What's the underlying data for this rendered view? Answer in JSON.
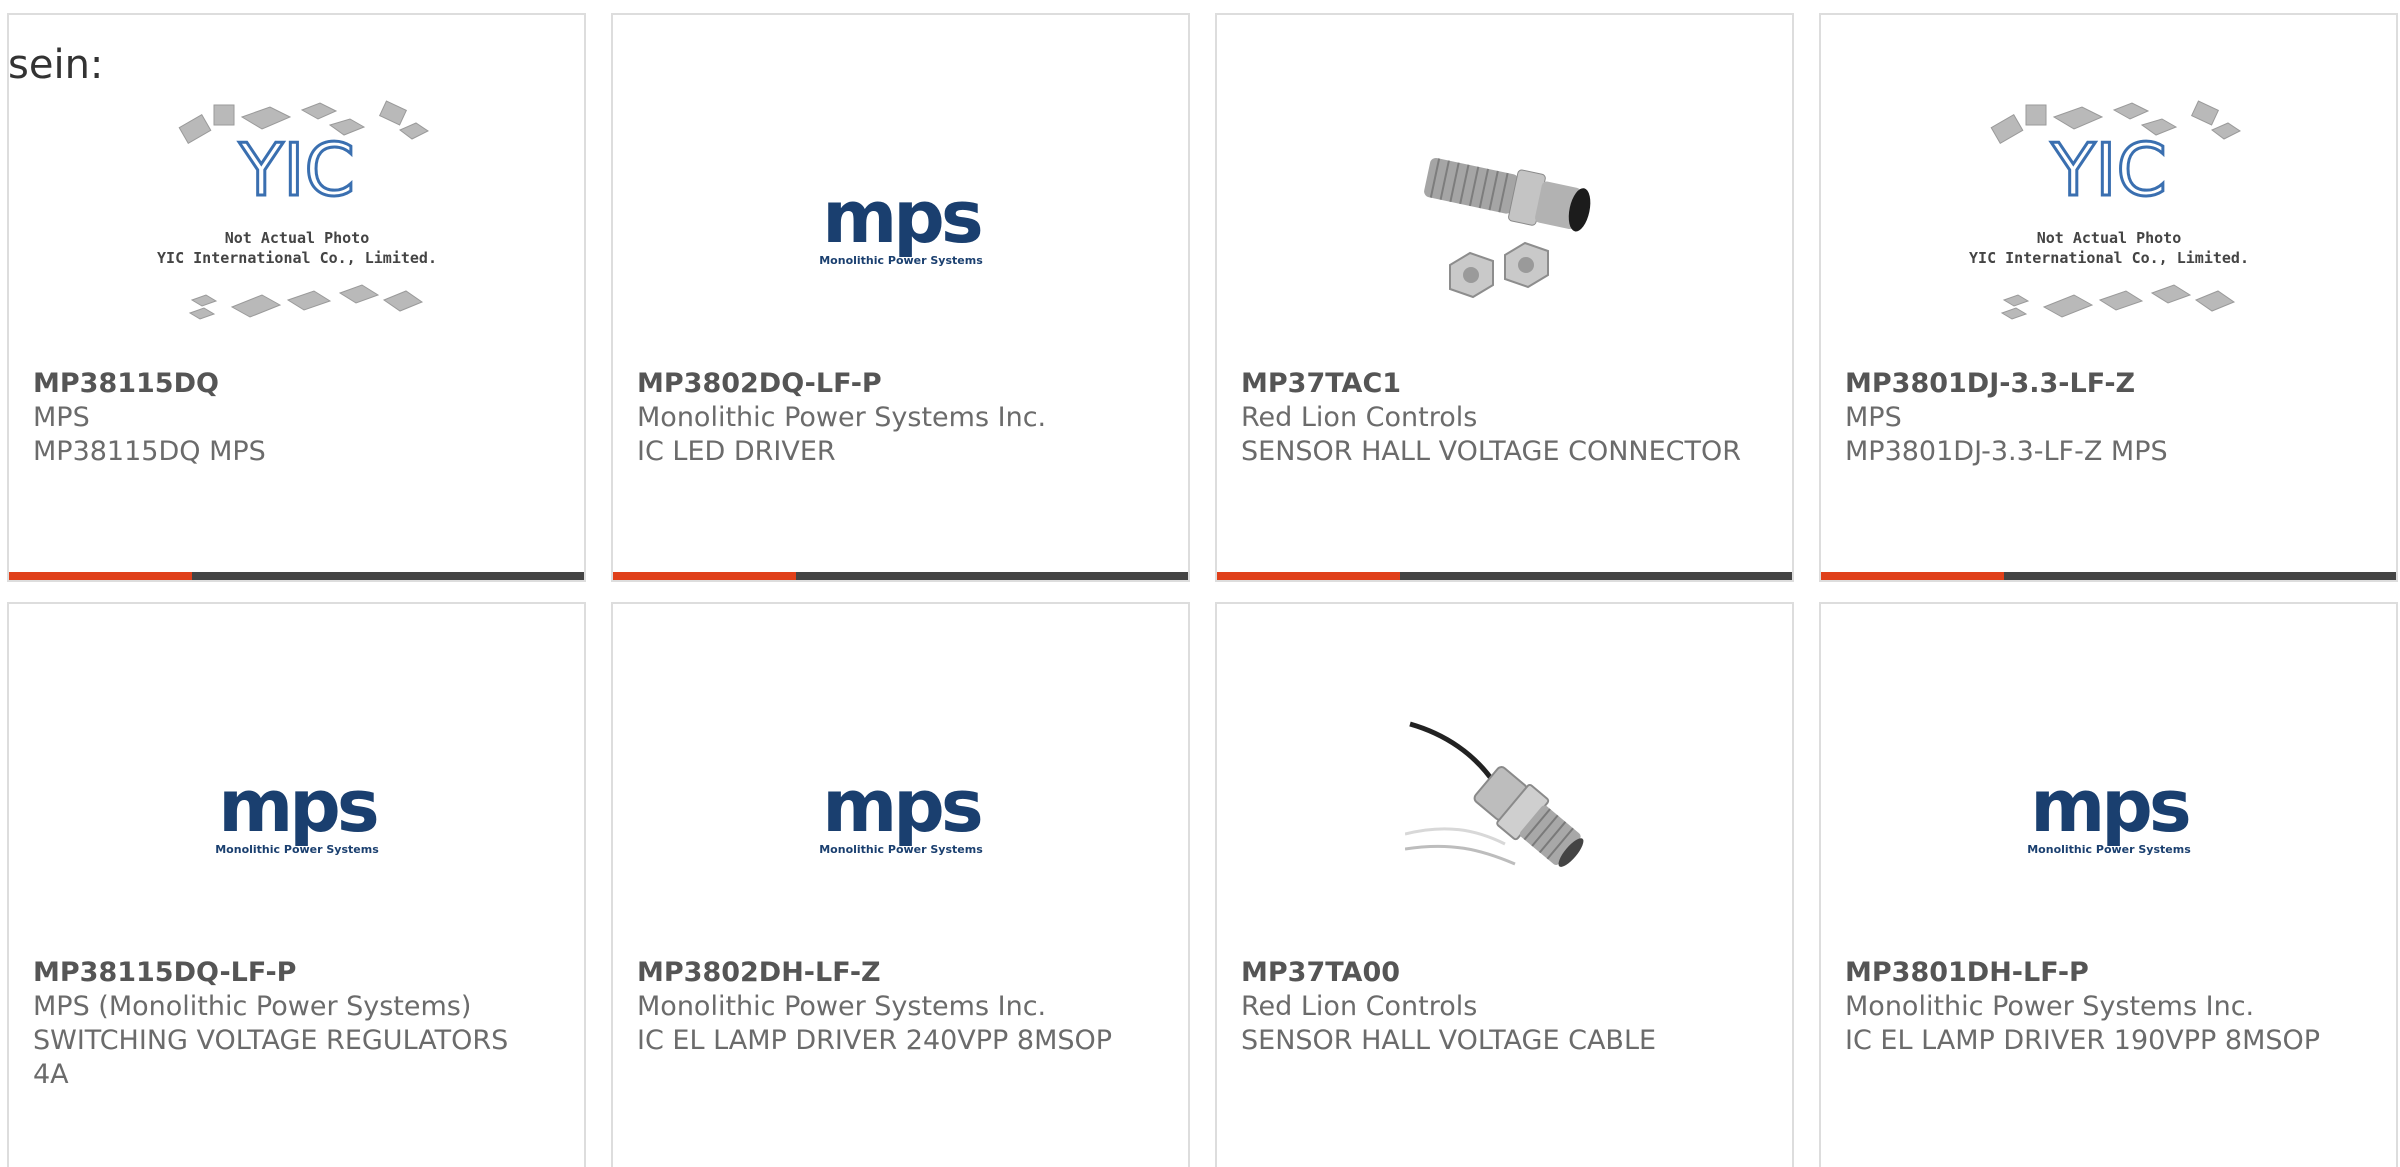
{
  "header": {
    "text": "sein:"
  },
  "colors": {
    "accent": "#e0401a",
    "bar": "#444444",
    "mps_blue": "#1a3f6f"
  },
  "products": [
    {
      "part": "MP38115DQ",
      "maker": "MPS",
      "desc": "MP38115DQ MPS",
      "image": "yic-placeholder",
      "image_text": [
        "Not Actual Photo",
        "YIC International Co., Limited."
      ]
    },
    {
      "part": "MP3802DQ-LF-P",
      "maker": "Monolithic Power Systems Inc.",
      "desc": "IC LED DRIVER",
      "image": "mps-logo",
      "image_text": [
        "Monolithic Power Systems"
      ]
    },
    {
      "part": "MP37TAC1",
      "maker": "Red Lion Controls",
      "desc": "SENSOR HALL VOLTAGE CONNECTOR",
      "image": "sensor-connector-photo"
    },
    {
      "part": "MP3801DJ-3.3-LF-Z",
      "maker": "MPS",
      "desc": "MP3801DJ-3.3-LF-Z MPS",
      "image": "yic-placeholder",
      "image_text": [
        "Not Actual Photo",
        "YIC International Co., Limited."
      ]
    },
    {
      "part": "MP38115DQ-LF-P",
      "maker": "MPS (Monolithic Power Systems)",
      "desc": "SWITCHING VOLTAGE REGULATORS 4A",
      "image": "mps-logo",
      "image_text": [
        "Monolithic Power Systems"
      ]
    },
    {
      "part": "MP3802DH-LF-Z",
      "maker": "Monolithic Power Systems Inc.",
      "desc": "IC EL LAMP DRIVER 240VPP 8MSOP",
      "image": "mps-logo",
      "image_text": [
        "Monolithic Power Systems"
      ]
    },
    {
      "part": "MP37TA00",
      "maker": "Red Lion Controls",
      "desc": "SENSOR HALL VOLTAGE CABLE",
      "image": "sensor-cable-photo"
    },
    {
      "part": "MP3801DH-LF-P",
      "maker": "Monolithic Power Systems Inc.",
      "desc": "IC EL LAMP DRIVER 190VPP 8MSOP",
      "image": "mps-logo",
      "image_text": [
        "Monolithic Power Systems"
      ]
    }
  ]
}
